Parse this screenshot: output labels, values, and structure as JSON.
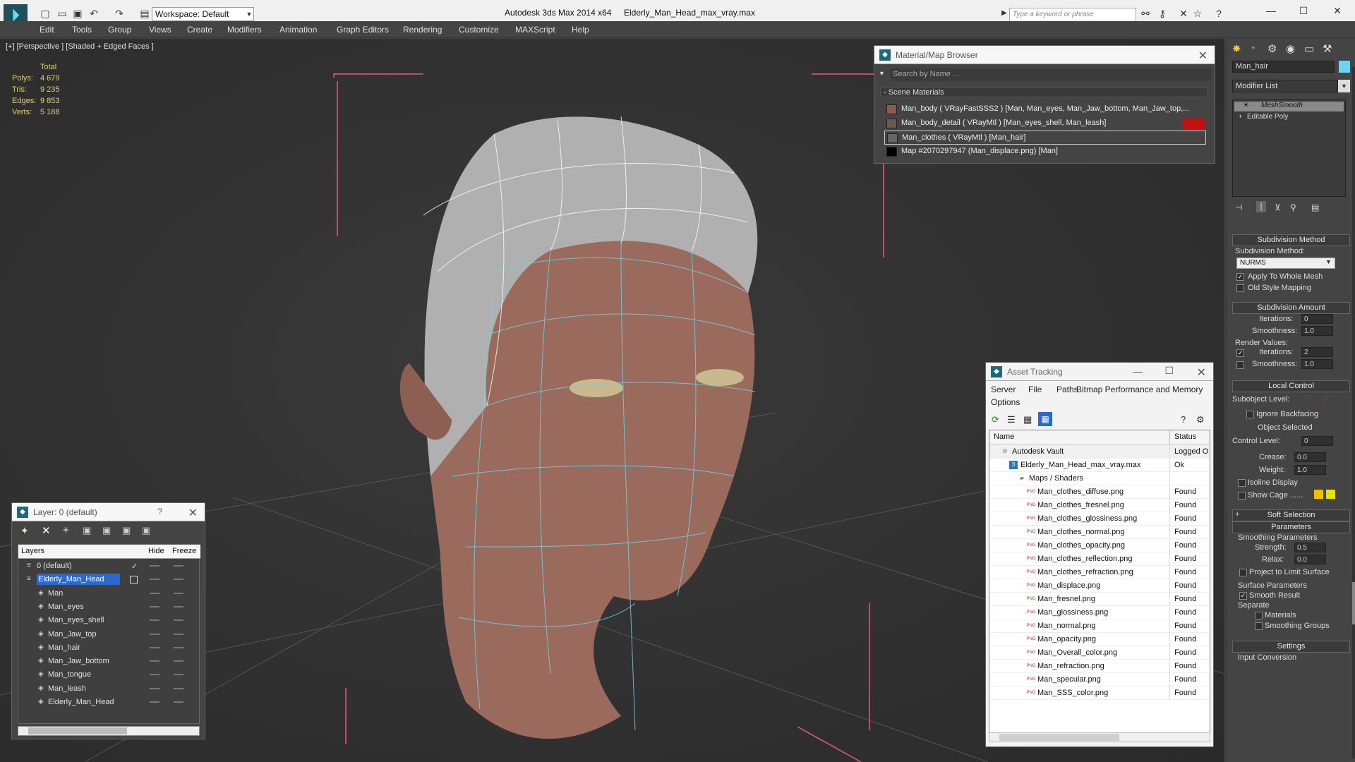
{
  "titlebar": {
    "workspace": "Workspace: Default",
    "app_title": "Autodesk 3ds Max  2014 x64",
    "file_title": "Elderly_Man_Head_max_vray.max",
    "search_placeholder": "Type a keyword or phrase"
  },
  "menu": [
    "Edit",
    "Tools",
    "Group",
    "Views",
    "Create",
    "Modifiers",
    "Animation",
    "Graph Editors",
    "Rendering",
    "Customize",
    "MAXScript",
    "Help"
  ],
  "viewport": {
    "label": "[+] [Perspective ] [Shaded + Edged Faces ]",
    "stats_header": "Total",
    "stats": [
      {
        "k": "Polys:",
        "v": "4 679"
      },
      {
        "k": "Tris:",
        "v": "9 235"
      },
      {
        "k": "Edges:",
        "v": "9 853"
      },
      {
        "k": "Verts:",
        "v": "5 188"
      }
    ]
  },
  "material_browser": {
    "title": "Material/Map Browser",
    "search": "Search by Name ...",
    "section": "- Scene Materials",
    "rows": [
      {
        "label": "Man_body  ( VRayFastSSS2 )  [Man, Man_eyes, Man_Jaw_bottom, Man_Jaw_top,...",
        "swatch": "#8a5a4a"
      },
      {
        "label": "Man_body_detail  ( VRayMtl )  [Man_eyes_shell, Man_leash]",
        "swatch": "#6a5a50"
      },
      {
        "label": "Man_clothes  ( VRayMtl )  [Man_hair]",
        "swatch": "#666666"
      },
      {
        "label": "Map #2070297947 (Man_displace.png)  [Man]",
        "swatch": "#000000"
      }
    ]
  },
  "asset_tracking": {
    "title": "Asset Tracking",
    "menu": [
      "Server",
      "File",
      "Paths",
      "Bitmap Performance and Memory",
      "Options"
    ],
    "col_name": "Name",
    "col_status": "Status",
    "rows": [
      {
        "name": "Autodesk Vault",
        "status": "Logged O",
        "indent": 1
      },
      {
        "name": "Elderly_Man_Head_max_vray.max",
        "status": "Ok",
        "indent": 2
      },
      {
        "name": "Maps / Shaders",
        "status": "",
        "indent": 3
      },
      {
        "name": "Man_clothes_diffuse.png",
        "status": "Found",
        "indent": 4
      },
      {
        "name": "Man_clothes_fresnel.png",
        "status": "Found",
        "indent": 4
      },
      {
        "name": "Man_clothes_glossiness.png",
        "status": "Found",
        "indent": 4
      },
      {
        "name": "Man_clothes_normal.png",
        "status": "Found",
        "indent": 4
      },
      {
        "name": "Man_clothes_opacity.png",
        "status": "Found",
        "indent": 4
      },
      {
        "name": "Man_clothes_reflection.png",
        "status": "Found",
        "indent": 4
      },
      {
        "name": "Man_clothes_refraction.png",
        "status": "Found",
        "indent": 4
      },
      {
        "name": "Man_displace.png",
        "status": "Found",
        "indent": 4
      },
      {
        "name": "Man_fresnel.png",
        "status": "Found",
        "indent": 4
      },
      {
        "name": "Man_glossiness.png",
        "status": "Found",
        "indent": 4
      },
      {
        "name": "Man_normal.png",
        "status": "Found",
        "indent": 4
      },
      {
        "name": "Man_opacity.png",
        "status": "Found",
        "indent": 4
      },
      {
        "name": "Man_Overall_color.png",
        "status": "Found",
        "indent": 4
      },
      {
        "name": "Man_refraction.png",
        "status": "Found",
        "indent": 4
      },
      {
        "name": "Man_specular.png",
        "status": "Found",
        "indent": 4
      },
      {
        "name": "Man_SSS_color.png",
        "status": "Found",
        "indent": 4
      }
    ]
  },
  "layers": {
    "title": "Layer: 0 (default)",
    "help": "?",
    "col_layers": "Layers",
    "col_hide": "Hide",
    "col_freeze": "Freeze",
    "rows": [
      {
        "name": "0 (default)",
        "indent": 1,
        "selected": false,
        "check": true
      },
      {
        "name": "Elderly_Man_Head",
        "indent": 1,
        "selected": true,
        "check": false
      },
      {
        "name": "Man",
        "indent": 2,
        "selected": false,
        "check": false
      },
      {
        "name": "Man_eyes",
        "indent": 2,
        "selected": false,
        "check": false
      },
      {
        "name": "Man_eyes_shell",
        "indent": 2,
        "selected": false,
        "check": false
      },
      {
        "name": "Man_Jaw_top",
        "indent": 2,
        "selected": false,
        "check": false
      },
      {
        "name": "Man_hair",
        "indent": 2,
        "selected": false,
        "check": false
      },
      {
        "name": "Man_Jaw_bottom",
        "indent": 2,
        "selected": false,
        "check": false
      },
      {
        "name": "Man_tongue",
        "indent": 2,
        "selected": false,
        "check": false
      },
      {
        "name": "Man_leash",
        "indent": 2,
        "selected": false,
        "check": false
      },
      {
        "name": "Elderly_Man_Head",
        "indent": 2,
        "selected": false,
        "check": false
      }
    ]
  },
  "command_panel": {
    "object_name": "Man_hair",
    "modifier_list": "Modifier List",
    "stack": [
      "MeshSmooth",
      "Editable Poly"
    ],
    "subdiv_method_title": "Subdivision Method",
    "subdiv_method_label": "Subdivision Method:",
    "subdiv_method_value": "NURMS",
    "apply_whole_mesh": "Apply To Whole Mesh",
    "old_style_mapping": "Old Style Mapping",
    "subdiv_amount_title": "Subdivision Amount",
    "iterations_label": "Iterations:",
    "iterations_value": "0",
    "smoothness_label": "Smoothness:",
    "smoothness_value": "1.0",
    "render_values": "Render Values:",
    "render_iterations_value": "2",
    "render_smoothness_value": "1.0",
    "local_control_title": "Local Control",
    "subobject_level": "Subobject Level:",
    "ignore_backfacing": "Ignore Backfacing",
    "object_selected": "Object Selected",
    "control_level": "Control Level:",
    "control_level_value": "0",
    "crease": "Crease:",
    "crease_value": "0.0",
    "weight": "Weight:",
    "weight_value": "1.0",
    "isoline_display": "Isoline Display",
    "show_cage": "Show Cage ......",
    "soft_selection_title": "Soft Selection",
    "parameters_title": "Parameters",
    "smoothing_params": "Smoothing Parameters",
    "strength": "Strength:",
    "strength_value": "0.5",
    "relax": "Relax:",
    "relax_value": "0.0",
    "project_limit": "Project to Limit Surface",
    "surface_params": "Surface Parameters",
    "smooth_result": "Smooth Result",
    "separate": "Separate",
    "materials": "Materials",
    "smoothing_groups": "Smoothing Groups",
    "settings_title": "Settings",
    "input_conversion": "Input Conversion"
  }
}
